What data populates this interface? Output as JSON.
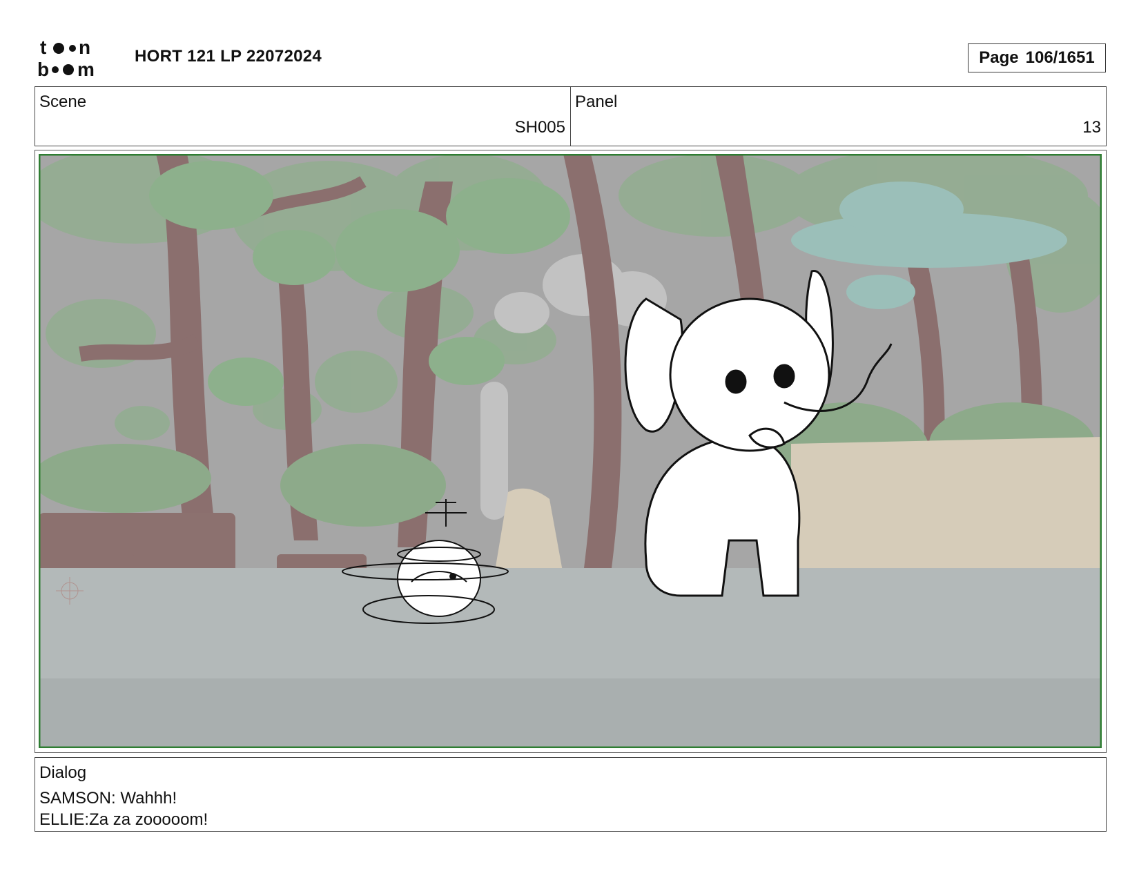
{
  "header": {
    "logo_lines": [
      "toon",
      "boom"
    ],
    "document_title": "HORT 121 LP 22072024",
    "page_label": "Page",
    "page_value": "106/1651"
  },
  "info": {
    "scene_label": "Scene",
    "scene_value": "SH005",
    "panel_label": "Panel",
    "panel_value": "13"
  },
  "dialog": {
    "label": "Dialog",
    "lines": [
      "SAMSON: Wahhh!",
      "ELLIE:Za za zooooom!"
    ]
  },
  "colors": {
    "panel_border": "#2e7d32",
    "background_gray": "#a9a9a9",
    "ground": "#b3b8b9",
    "foliage": "#8fae8c",
    "trunk": "#8a6f6c",
    "teal_tree": "#9cbfb8",
    "sand": "#d9d0be"
  }
}
